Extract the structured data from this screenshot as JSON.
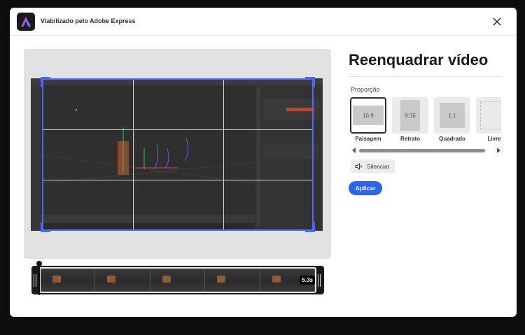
{
  "header": {
    "title": "Viabilizado pelo Adobe Express"
  },
  "panel": {
    "title": "Reenquadrar vídeo",
    "proportion_label": "Proporção",
    "ratios": [
      {
        "label": "Paisagem",
        "shape_text": "16:9",
        "selected": true
      },
      {
        "label": "Retrato",
        "shape_text": "9:16",
        "selected": false
      },
      {
        "label": "Quadrado",
        "shape_text": "1:1",
        "selected": false
      },
      {
        "label": "Livre",
        "shape_text": "",
        "selected": false
      }
    ],
    "mute_label": "Silenciar",
    "apply_label": "Aplicar"
  },
  "timeline": {
    "duration": "5.3s"
  },
  "colors": {
    "accent": "#4a67ff",
    "apply": "#2b64ee"
  }
}
